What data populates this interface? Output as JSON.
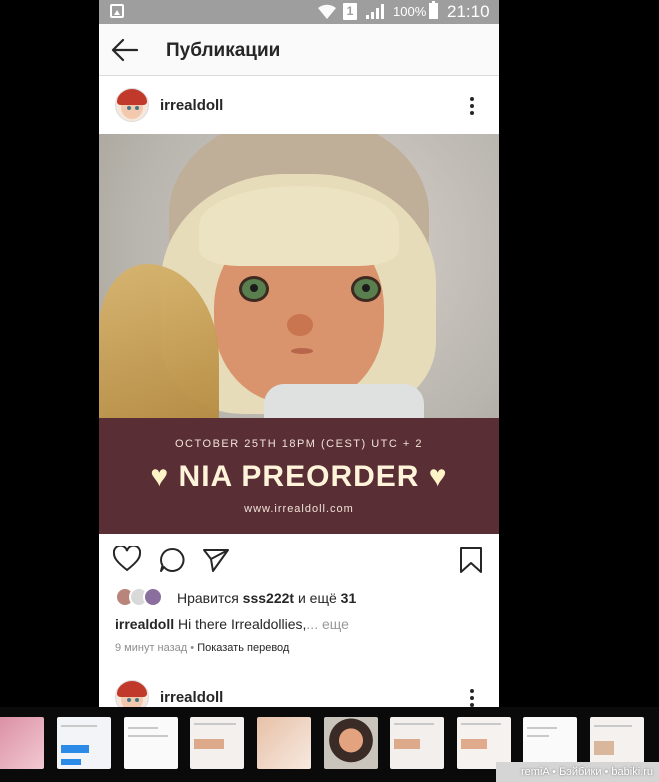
{
  "status_bar": {
    "sim_label": "1",
    "battery": "100%",
    "time": "21:10"
  },
  "header": {
    "title": "Публикации"
  },
  "post": {
    "username": "irrealdoll",
    "banner": {
      "date_line": "OCTOBER 25TH 18PM (CEST) UTC + 2",
      "heart": "♥",
      "title": "NIA PREORDER",
      "url": "www.irrealdoll.com"
    },
    "likes": {
      "prefix": "Нравится",
      "user": "sss222t",
      "middle": "и ещё",
      "count": "31"
    },
    "caption": {
      "user": "irrealdoll",
      "text": "Hi there Irrealdollies,",
      "more": "... еще"
    },
    "meta": {
      "time": "9 минут назад",
      "separator": "•",
      "translate": "Показать перевод"
    }
  },
  "next_post": {
    "username": "irrealdoll"
  },
  "watermark": "remiA • Бэйбики • babiki.ru",
  "colors": {
    "status_bar": "#9e9e9e",
    "banner": "#5a2e35",
    "text": "#262626",
    "muted": "#8e8e8e"
  },
  "icons": [
    "back-arrow-icon",
    "more-vertical-icon",
    "heart-outline-icon",
    "comment-icon",
    "share-icon",
    "bookmark-icon",
    "wifi-icon",
    "signal-icon",
    "battery-icon",
    "image-icon"
  ]
}
